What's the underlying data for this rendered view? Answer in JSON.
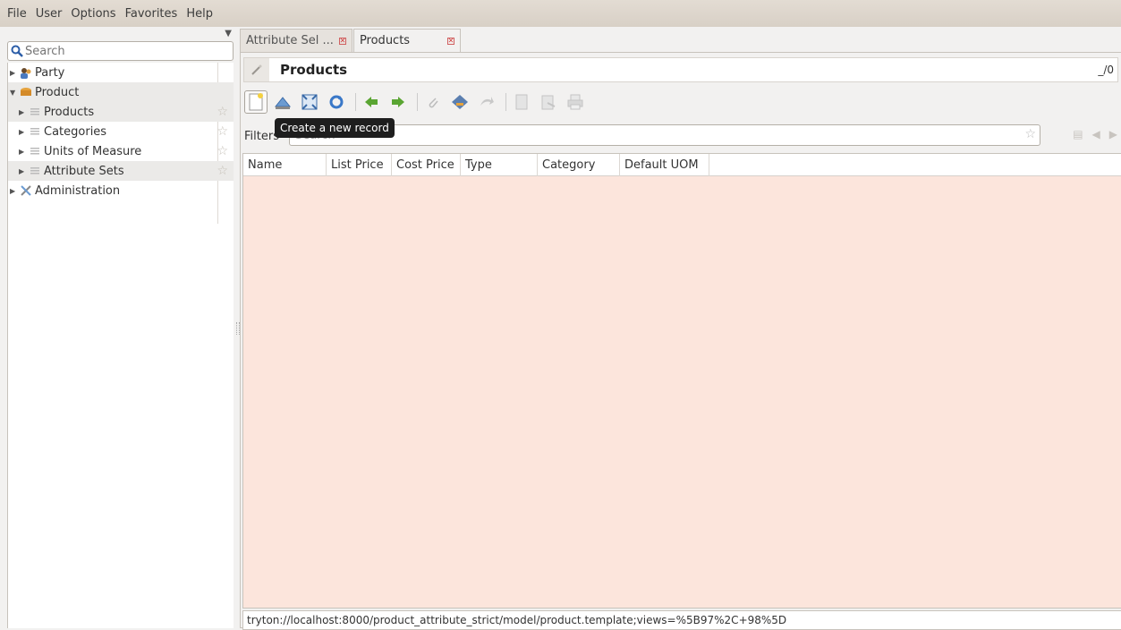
{
  "menubar": {
    "items": [
      "File",
      "User",
      "Options",
      "Favorites",
      "Help"
    ]
  },
  "sidebar": {
    "search_placeholder": "Search",
    "items": [
      {
        "label": "Party",
        "icon": "party-icon",
        "expanded": false
      },
      {
        "label": "Product",
        "icon": "product-icon",
        "expanded": true
      },
      {
        "label": "Products",
        "icon": "list-icon"
      },
      {
        "label": "Categories",
        "icon": "list-icon"
      },
      {
        "label": "Units of Measure",
        "icon": "list-icon"
      },
      {
        "label": "Attribute Sets",
        "icon": "list-icon"
      },
      {
        "label": "Administration",
        "icon": "administration-icon",
        "expanded": false
      }
    ]
  },
  "tabs": [
    {
      "label": "Attribute Sel ...",
      "active": false
    },
    {
      "label": "Products",
      "active": true
    }
  ],
  "form": {
    "title": "Products",
    "record_count": "_/0"
  },
  "toolbar": {
    "tooltip": "Create a new record"
  },
  "filter": {
    "label": "Filters",
    "placeholder": "Search"
  },
  "grid": {
    "columns": [
      "Name",
      "List Price",
      "Cost Price",
      "Type",
      "Category",
      "Default UOM"
    ],
    "rows": []
  },
  "status": {
    "url": "tryton://localhost:8000/product_attribute_strict/model/product.template;views=%5B97%2C+98%5D"
  },
  "colors": {
    "grid_background": "#fce5dc",
    "menubar": "#ddd5cb"
  }
}
